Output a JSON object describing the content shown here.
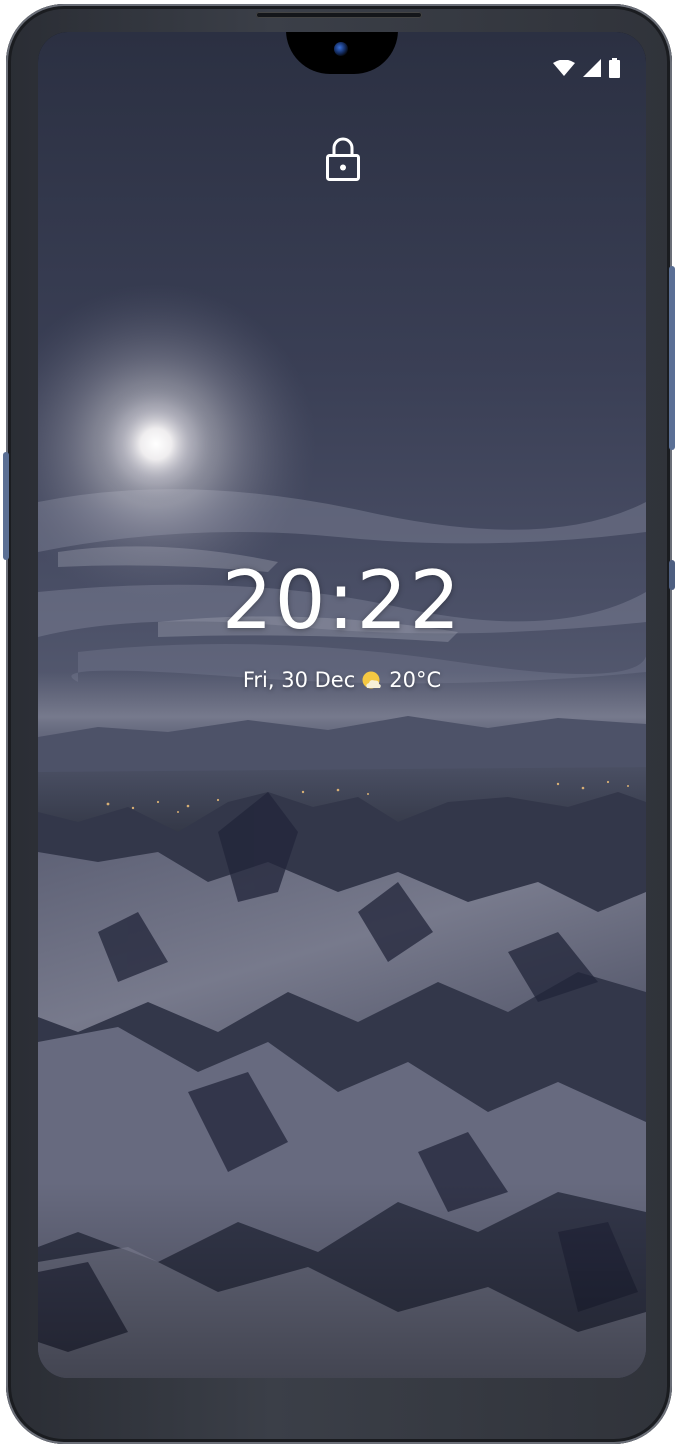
{
  "lockscreen": {
    "time": "20:22",
    "date": "Fri, 30 Dec",
    "temperature": "20°C"
  },
  "icons": {
    "status": [
      "wifi-icon",
      "cellular-signal-icon",
      "battery-icon"
    ],
    "lock": "lock-icon",
    "weather": "partly-cloudy-icon"
  },
  "colors": {
    "text": "#ffffff",
    "weather_sun": "#f5c842",
    "frame_accent": "#5a6f95"
  }
}
